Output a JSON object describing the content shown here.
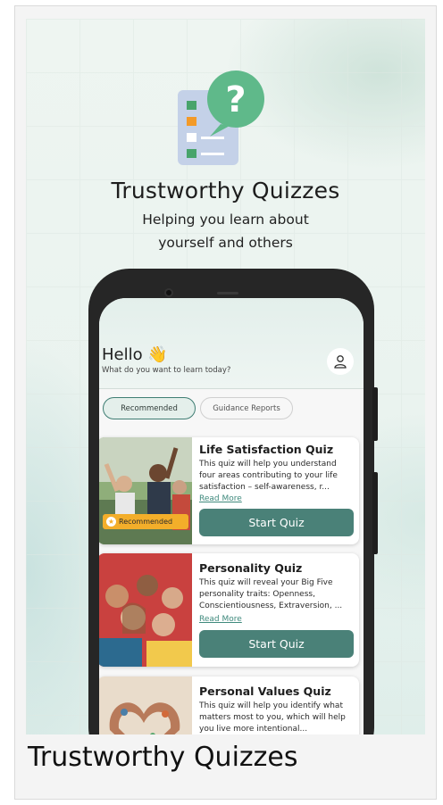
{
  "listing": {
    "headline": "Trustworthy Quizzes",
    "subline": "Helping you learn about yourself and others",
    "caption": "Trustworthy Quizzes"
  },
  "app": {
    "greeting": "Hello 👋",
    "prompt": "What do you want to learn today?",
    "tabs": [
      {
        "label": "Recommended",
        "active": true
      },
      {
        "label": "Guidance Reports",
        "active": false
      }
    ],
    "quizzes": [
      {
        "title": "Life Satisfaction Quiz",
        "description": "This quiz will help you understand four areas contributing to your life satisfaction – self-awareness, r...",
        "read_more": "Read More",
        "button": "Start Quiz",
        "badge": "Recommended"
      },
      {
        "title": "Personality Quiz",
        "description": "This quiz will reveal your Big Five personality traits: Openness, Conscientiousness, Extraversion, ...",
        "read_more": "Read More",
        "button": "Start Quiz"
      },
      {
        "title": "Personal Values Quiz",
        "description": "This quiz will help you identify what matters most to you, which will help you live more intentional..."
      }
    ]
  },
  "colors": {
    "accent": "#4a8178",
    "badge": "#f3ae2a",
    "icon_bubble": "#5fb98a"
  },
  "icons": [
    "quiz-checklist-icon",
    "question-bubble-icon",
    "user-icon",
    "star-icon"
  ]
}
